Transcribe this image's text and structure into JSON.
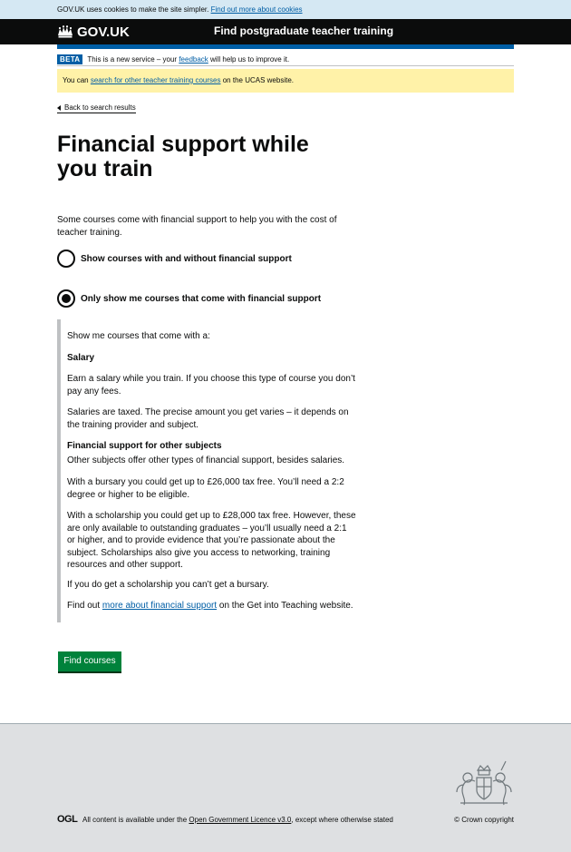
{
  "cookie_banner": {
    "text": "GOV.UK uses cookies to make the site simpler.",
    "link": "Find out more about cookies"
  },
  "header": {
    "logo": "GOV.UK",
    "service_name": "Find postgraduate teacher training"
  },
  "beta": {
    "tag": "BETA",
    "text_before": "This is a new service – your",
    "link": "feedback",
    "text_after": "will help us to improve it."
  },
  "notice": {
    "text_before": "You can",
    "link": "search for other teacher training courses",
    "text_after": "on the UCAS website."
  },
  "back_link": "Back to search results",
  "title": "Financial support while you train",
  "intro": "Some courses come with financial support to help you with the cost of teacher training.",
  "options": [
    {
      "label": "Show courses with and without financial support",
      "checked": false
    },
    {
      "label": "Only show me courses that come with financial support",
      "checked": true
    }
  ],
  "panel": {
    "lead": "Show me courses that come with a:",
    "salary_heading": "Salary",
    "salary_p1": "Earn a salary while you train. If you choose this type of course you don’t pay any fees.",
    "salary_p2": "Salaries are taxed. The precise amount you get varies – it depends on the training provider and subject.",
    "other_heading": "Financial support for other subjects",
    "other_p1": "Other subjects offer other types of financial support, besides salaries.",
    "other_p2": "With a bursary you could get up to £26,000 tax free. You’ll need a 2:2 degree or higher to be eligible.",
    "other_p3": "With a scholarship you could get up to £28,000 tax free. However, these are only available to outstanding graduates – you’ll usually need a 2:1 or higher, and to provide evidence that you’re passionate about the subject. Scholarships also give you access to networking, training resources and other support.",
    "other_p4": "If you do get a scholarship you can’t get a bursary.",
    "find_out_before": "Find out",
    "find_out_link": "more about financial support",
    "find_out_after": "on the Get into Teaching website."
  },
  "submit_label": "Find courses",
  "footer": {
    "ogl": "OGL",
    "licence_before": "All content is available under the",
    "licence_link": "Open Government Licence v3.0",
    "licence_after": ", except where otherwise stated",
    "copyright": "© Crown copyright"
  }
}
